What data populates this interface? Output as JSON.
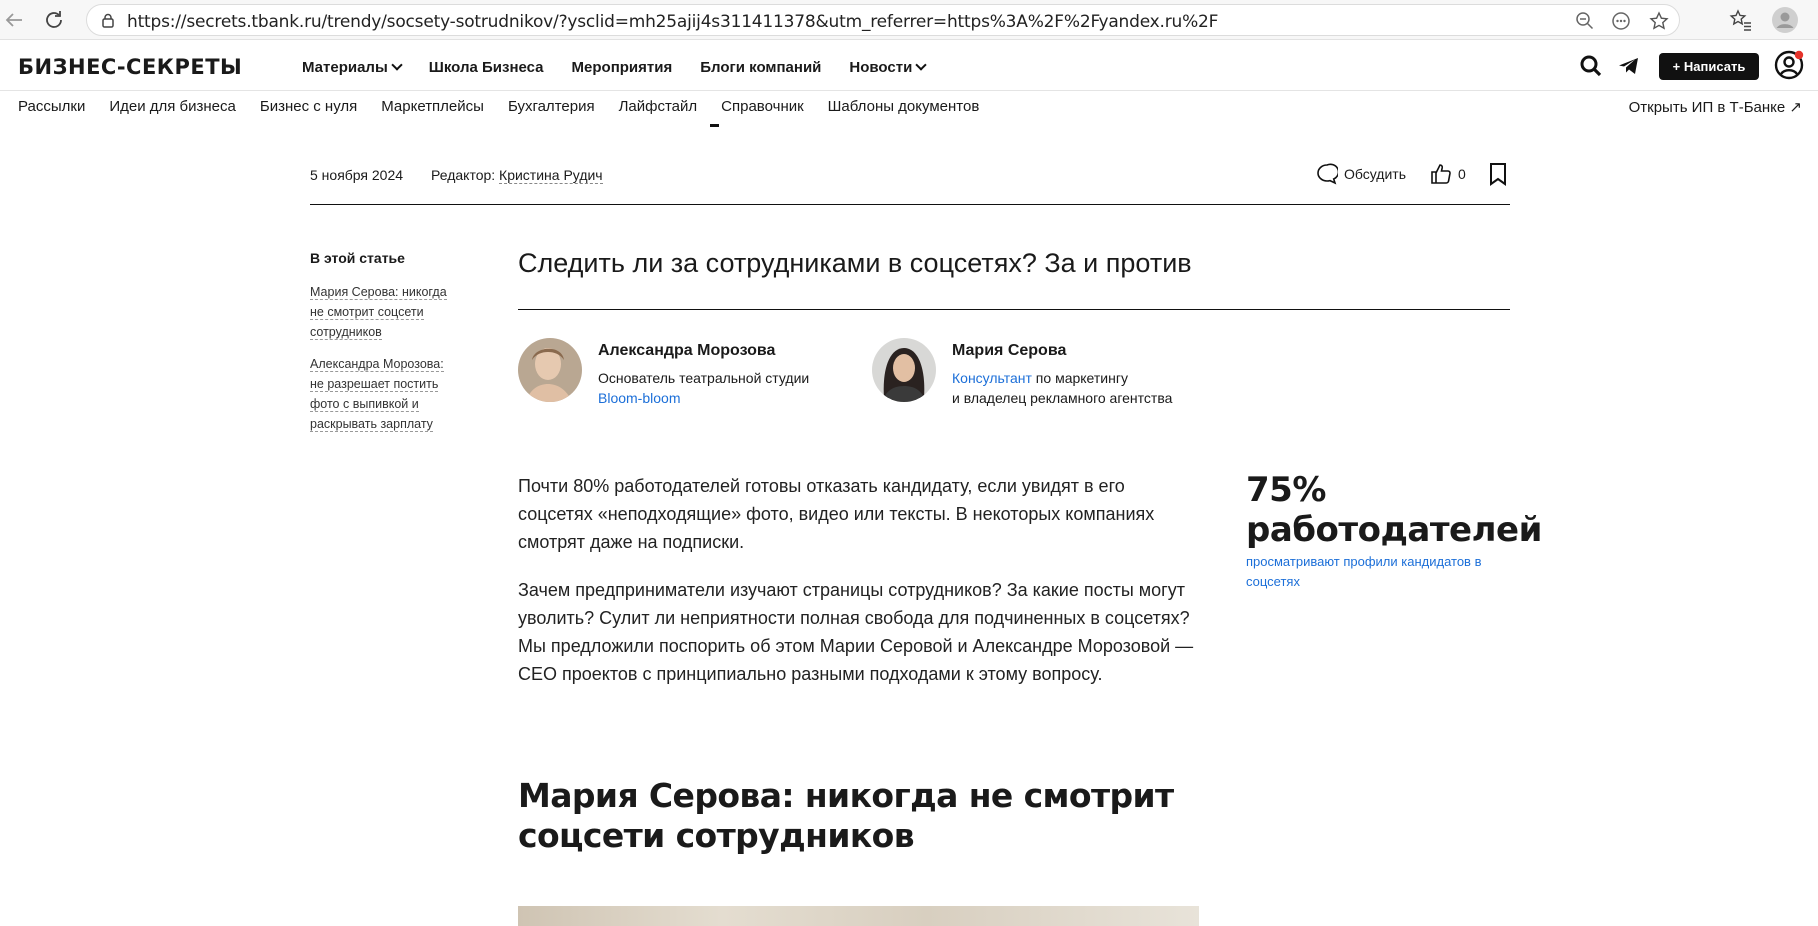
{
  "browser": {
    "url": "https://secrets.tbank.ru/trendy/socsety-sotrudnikov/?ysclid=mh25ajij4s311411378&utm_referrer=https%3A%2F%2Fyandex.ru%2F"
  },
  "site": {
    "logo": "БИЗНЕС-СЕКРЕТЫ",
    "main_nav": [
      "Материалы",
      "Школа Бизнеса",
      "Мероприятия",
      "Блоги компаний",
      "Новости"
    ],
    "write_label": "Написать",
    "sub_nav": [
      "Рассылки",
      "Идеи для бизнеса",
      "Бизнес с нуля",
      "Маркетплейсы",
      "Бухгалтерия",
      "Лайфстайл",
      "Справочник",
      "Шаблоны документов"
    ],
    "open_ip": "Открыть ИП в Т‑Банке ↗"
  },
  "meta": {
    "date": "5 ноября 2024",
    "editor_label": "Редактор: ",
    "editor_name": "Кристина Рудич",
    "discuss": "Обсудить",
    "likes": "0"
  },
  "toc": {
    "title": "В этой статье",
    "items": [
      "Мария Серова: никогда не смотрит соцсети сотрудников",
      "Александра Морозова: не разрешает постить фото с выпивкой и раскрывать зарплату"
    ]
  },
  "article": {
    "title": "Следить ли за сотрудниками в соцсетях? За и против",
    "authors": [
      {
        "name": "Александра Морозова",
        "role_line1": "Основатель театральной студии",
        "role_link": "Bloom-bloom"
      },
      {
        "name": "Мария Серова",
        "role_link": "Консультант",
        "role_line1_rest": " по маркетингу",
        "role_line2": "и владелец рекламного агентства"
      }
    ],
    "paragraphs": [
      "Почти 80% работодателей готовы отказать кандидату, если увидят в его соцсетях «неподходящие» фото, видео или тексты. В некоторых компаниях смотрят даже на подписки.",
      "Зачем предприниматели изучают страницы сотрудников? За какие посты могут уволить? Сулит ли неприятности полная свобода для подчиненных в соцсетях? Мы предложили поспорить об этом Марии Серовой и Александре Морозовой — CEO проектов с принципиально разными подходами к этому вопросу."
    ],
    "stat": {
      "number": "75% работодателей",
      "description": "просматривают профили кандидатов в соцсетях"
    },
    "section_heading": "Мария Серова: никогда не смотрит соцсети сотрудников"
  },
  "colors": {
    "accent_link": "#1c6fd8",
    "button_bg": "#111111",
    "notification": "#e5332a"
  }
}
